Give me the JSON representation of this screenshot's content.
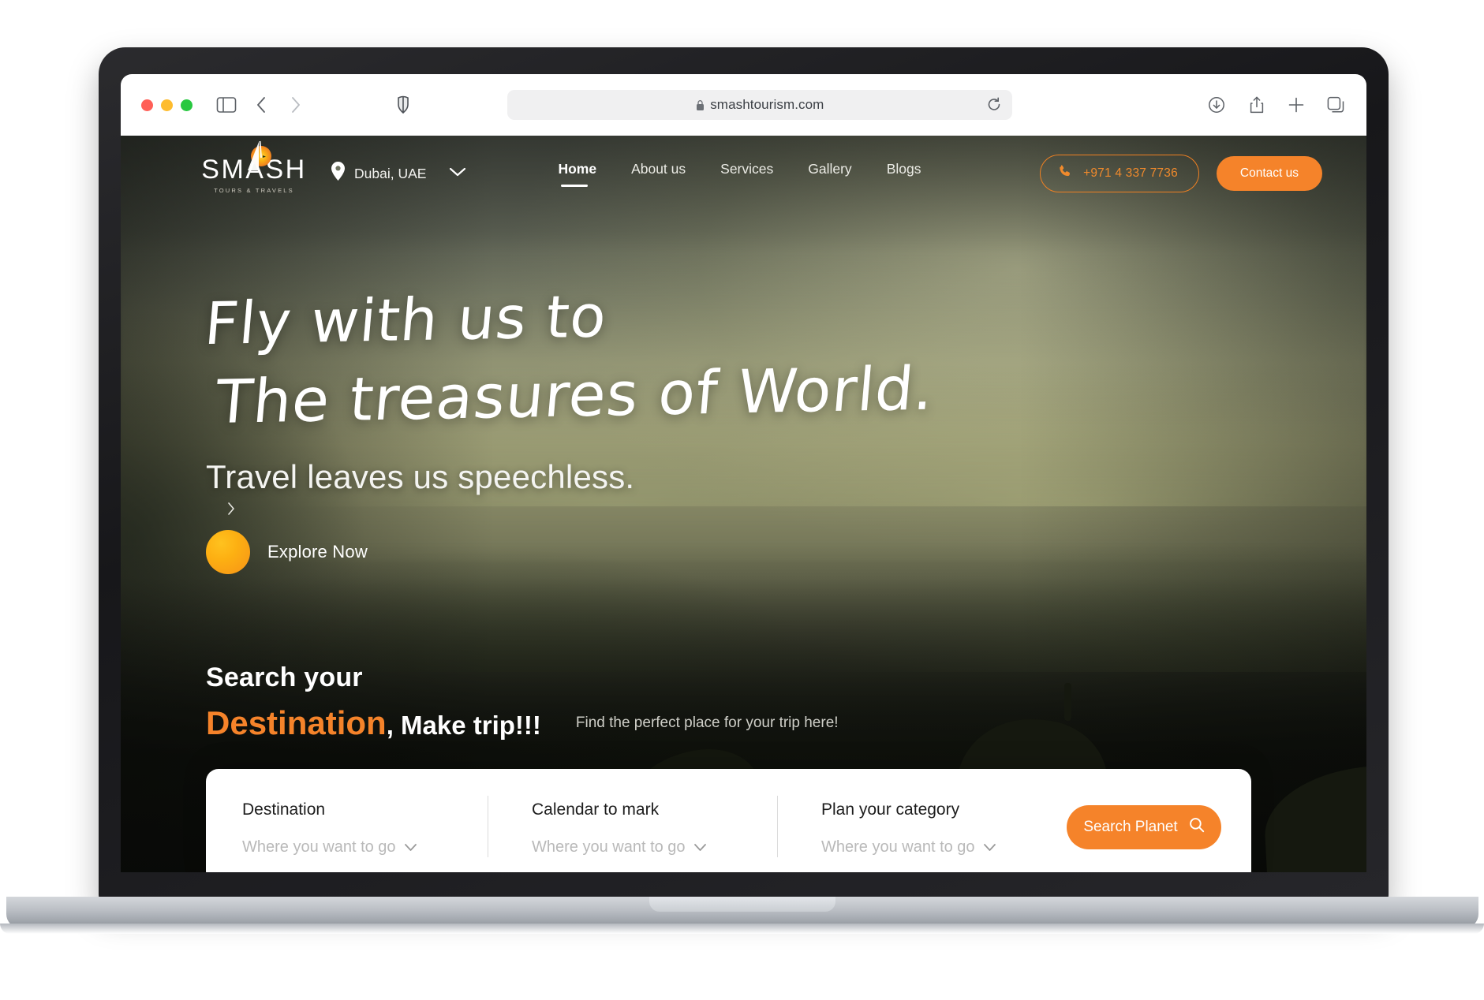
{
  "browser": {
    "app": "Safari",
    "url": "smashtourism.com",
    "lock_icon": "lock-icon",
    "reload_icon": "reload-icon",
    "sidebar_icon": "sidebar-toggle-icon",
    "back_icon": "back-chevron-icon",
    "forward_icon": "forward-chevron-icon",
    "shield_icon": "privacy-shield-icon",
    "downloads_icon": "downloads-icon",
    "share_icon": "share-icon",
    "new_tab_icon": "plus-icon",
    "tabs_icon": "tab-overview-icon",
    "traffic_lights": [
      "close-red",
      "minimize-yellow",
      "maximize-green"
    ]
  },
  "site": {
    "brand": {
      "name": "SMASH",
      "tagline": "TOURS & TRAVELS",
      "mark_icon": "sun-sail-logo-icon"
    },
    "location": {
      "label": "Dubai, UAE",
      "pin_icon": "map-pin-icon",
      "chevron_icon": "chevron-down-icon"
    },
    "nav": [
      {
        "label": "Home",
        "active": true
      },
      {
        "label": "About us",
        "active": false
      },
      {
        "label": "Services",
        "active": false
      },
      {
        "label": "Gallery",
        "active": false
      },
      {
        "label": "Blogs",
        "active": false
      }
    ],
    "phone": {
      "label": "+971 4 337 7736",
      "icon": "phone-icon"
    },
    "contact_button": "Contact us",
    "hero": {
      "script_line_1": "Fly with us to",
      "script_line_2": "The treasures of World.",
      "subtitle": "Travel leaves us speechless.",
      "next_icon": "chevron-right-icon",
      "cta_label": "Explore Now",
      "cta_icon": "explore-circle-icon"
    },
    "search_section": {
      "heading_line_1": "Search your",
      "heading_highlight": "Destination",
      "heading_rest": ", Make trip!!!",
      "hint": "Find the perfect place for your trip here!",
      "fields": [
        {
          "label": "Destination",
          "value": "Where you want to go",
          "chevron": "chevron-down-icon"
        },
        {
          "label": "Calendar to mark",
          "value": "Where you want to go",
          "chevron": "chevron-down-icon"
        },
        {
          "label": "Plan your category",
          "value": "Where you want to go",
          "chevron": "chevron-down-icon"
        }
      ],
      "button": {
        "label": "Search Planet",
        "icon": "search-icon"
      }
    }
  },
  "colors": {
    "accent_orange": "#f5832a",
    "accent_orange_text": "#f08a2c",
    "cta_yellow": "#ffc21f",
    "hero_text": "#ffffff",
    "card_bg": "#ffffff",
    "placeholder": "#b9b9b9"
  }
}
